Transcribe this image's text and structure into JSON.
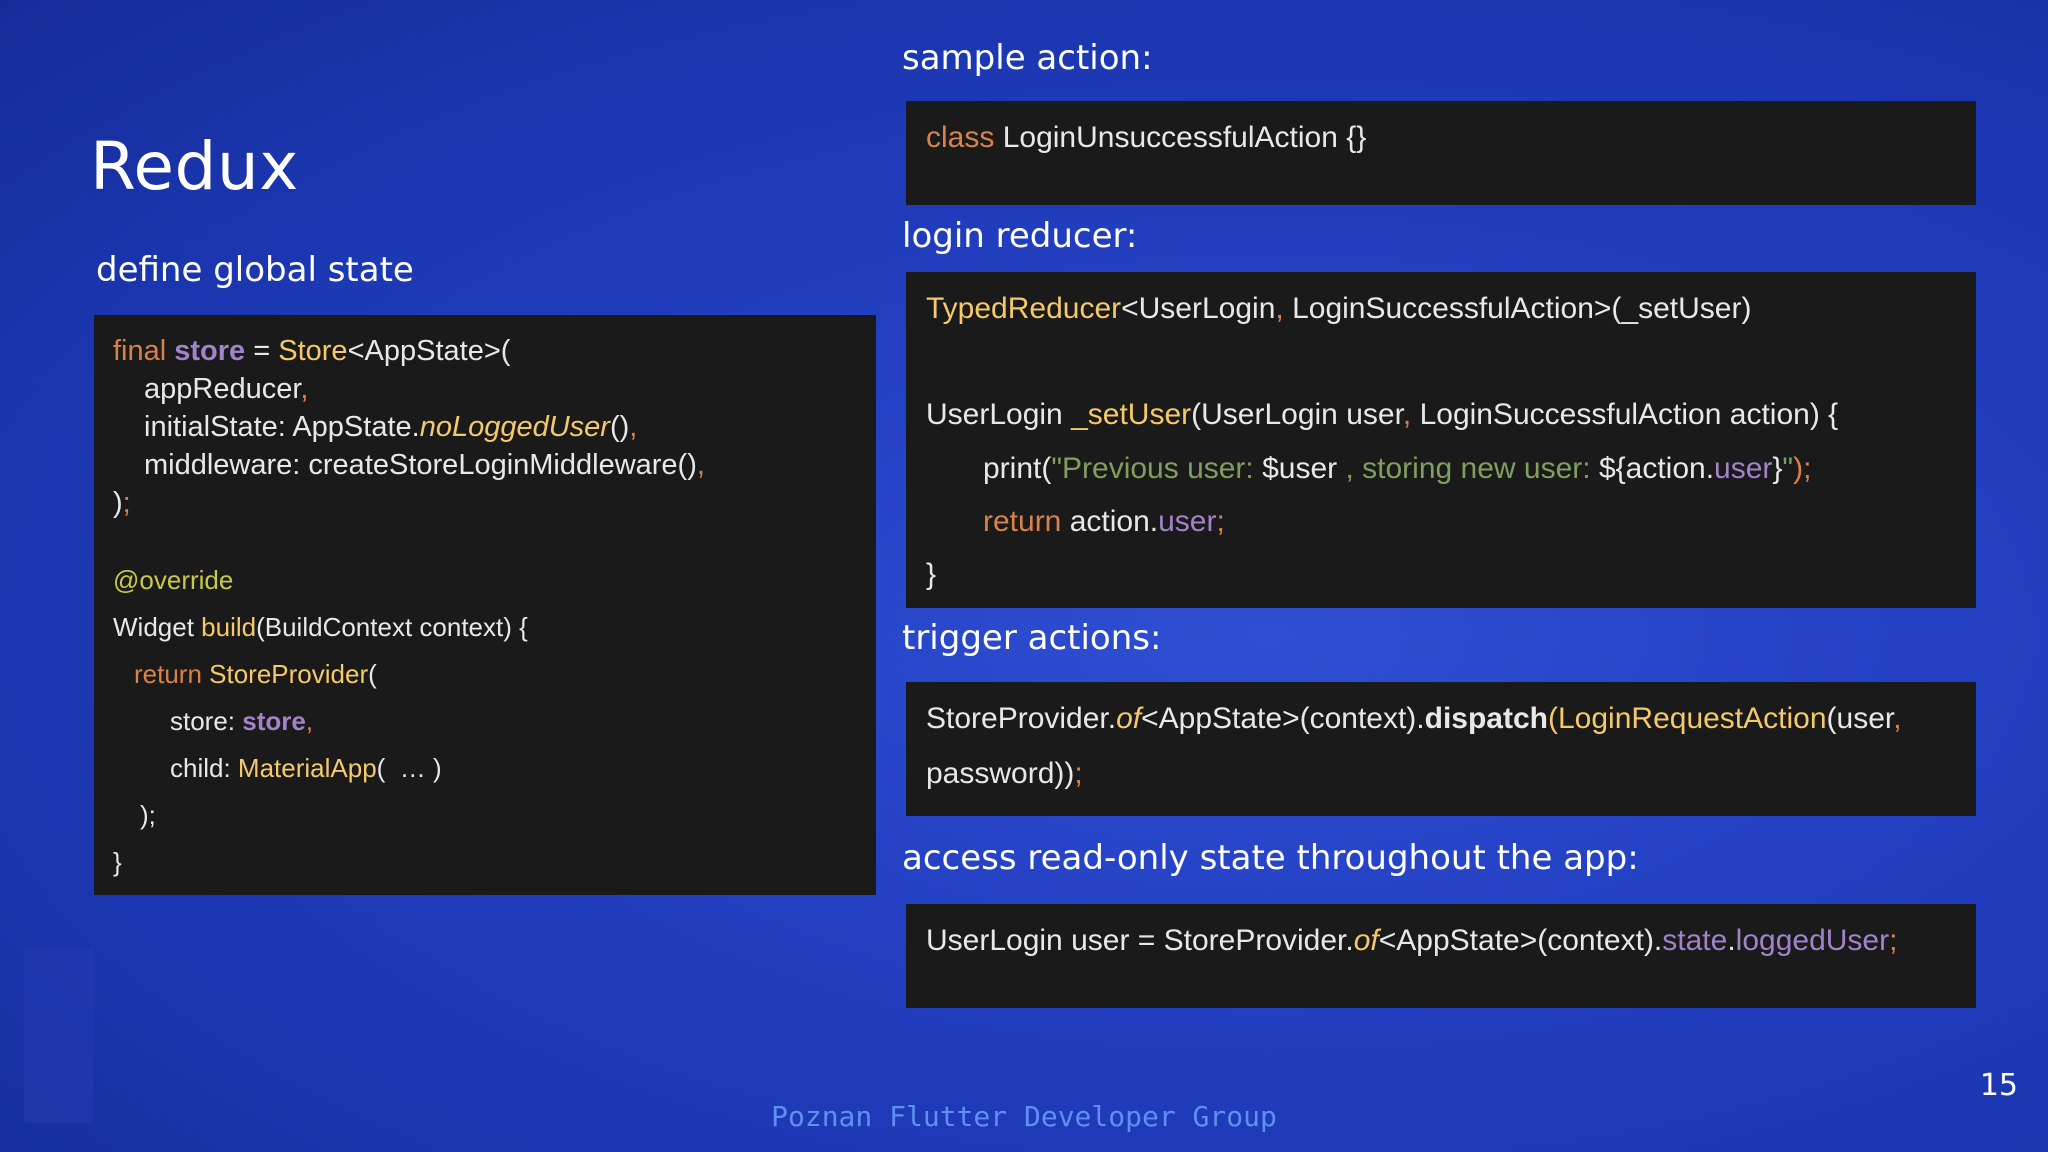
{
  "slide": {
    "title": "Redux",
    "page_number": "15",
    "footer": "Poznan Flutter Developer Group"
  },
  "labels": {
    "define_state": "define global state",
    "sample_action": "sample action:",
    "login_reducer": "login reducer:",
    "trigger_actions": "trigger actions:",
    "access_state": "access read-only state throughout the app:"
  },
  "colors": {
    "background": "#1f3bb8",
    "code_background": "#1a1a1a",
    "keyword": "#d8824a",
    "function": "#f5c96a",
    "property": "#a083c9",
    "string": "#7f9f5e",
    "footer_text": "#5f8ff0"
  },
  "code": {
    "state": {
      "l1": {
        "a": "final",
        "b": " ",
        "c": "store",
        "d": " = ",
        "e": "Store",
        "f": "<AppState>("
      },
      "l2": {
        "a": "appReducer",
        "b": ","
      },
      "l3": {
        "a": "initialState: AppState.",
        "b": "noLoggedUser",
        "c": "()",
        "d": ","
      },
      "l4": {
        "a": "middleware: createStoreLoginMiddleware()",
        "b": ","
      },
      "l5": {
        "a": ")",
        "b": ";"
      },
      "l6": {
        "a": "@override"
      },
      "l7": {
        "a": "Widget ",
        "b": "build",
        "c": "(BuildContext context) {"
      },
      "l8": {
        "a": "return",
        "b": " ",
        "c": "StoreProvider",
        "d": "("
      },
      "l9": {
        "a": "store: ",
        "b": "store",
        "c": ","
      },
      "l10": {
        "a": "child: ",
        "b": "MaterialApp",
        "c": "(  … )"
      },
      "l11": {
        "a": ");"
      },
      "l12": {
        "a": "}"
      }
    },
    "action": {
      "l1": {
        "a": "class",
        "b": " LoginUnsuccessfulAction {}"
      }
    },
    "reducer": {
      "l1": {
        "a": "TypedReducer",
        "b": "<UserLogin",
        "c": ",",
        "d": " LoginSuccessfulAction>(_setUser)"
      },
      "l2": {
        "a": "UserLogin ",
        "b": "_setUser",
        "c": "(UserLogin user",
        "d": ",",
        "e": " LoginSuccessfulAction action) {"
      },
      "l3": {
        "a": "print(",
        "b": "\"Previous user: ",
        "c": "$user",
        "d": " , storing new user: ",
        "e": "${action.",
        "f": "user",
        "g": "}",
        "h": "\"",
        "i": ");"
      },
      "l4": {
        "a": "return",
        "b": " action.",
        "c": "user",
        "d": ";"
      },
      "l5": {
        "a": "}"
      }
    },
    "trigger": {
      "l1": {
        "a": "StoreProvider.",
        "b": "of",
        "c": "<AppState>(context).",
        "d": "dispatch",
        "e": "(",
        "f": "LoginRequestAction",
        "g": "(user",
        "h": ","
      },
      "l2": {
        "a": "password))",
        "b": ";"
      }
    },
    "access": {
      "l1": {
        "a": "UserLogin user = StoreProvider.",
        "b": "of",
        "c": "<AppState>(context).",
        "d": "state",
        "e": ".",
        "f": "loggedUser",
        "g": ";"
      }
    }
  }
}
